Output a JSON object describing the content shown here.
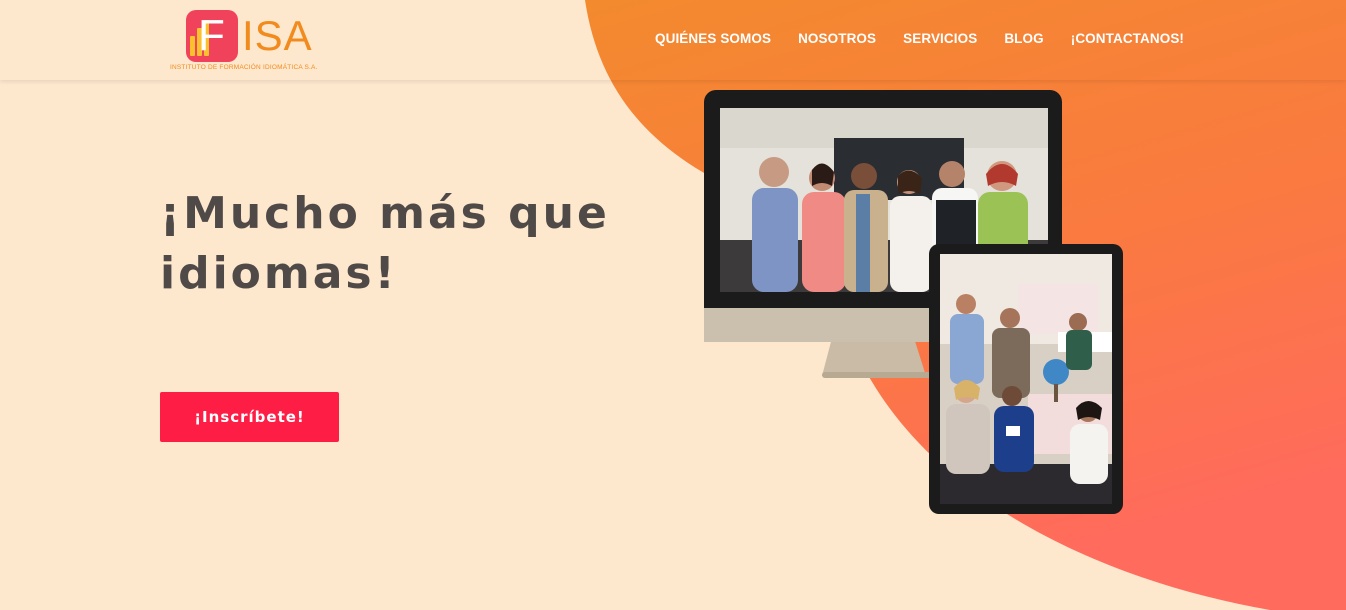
{
  "brand": {
    "letter": "F",
    "name": "ISA",
    "subtitle": "INSTITUTO DE FORMACIÓN IDIOMÁTICA S.A."
  },
  "nav": {
    "items": [
      "QUIÉNES SOMOS",
      "NOSOTROS",
      "SERVICIOS",
      "BLOG",
      "¡CONTACTANOS!"
    ]
  },
  "hero": {
    "title": "¡Mucho más que idiomas!",
    "cta_label": "¡Inscríbete!"
  },
  "colors": {
    "background": "#fde7cd",
    "accent_orange": "#f28b1d",
    "accent_red": "#fd1d45",
    "heading": "#4f4a48"
  }
}
